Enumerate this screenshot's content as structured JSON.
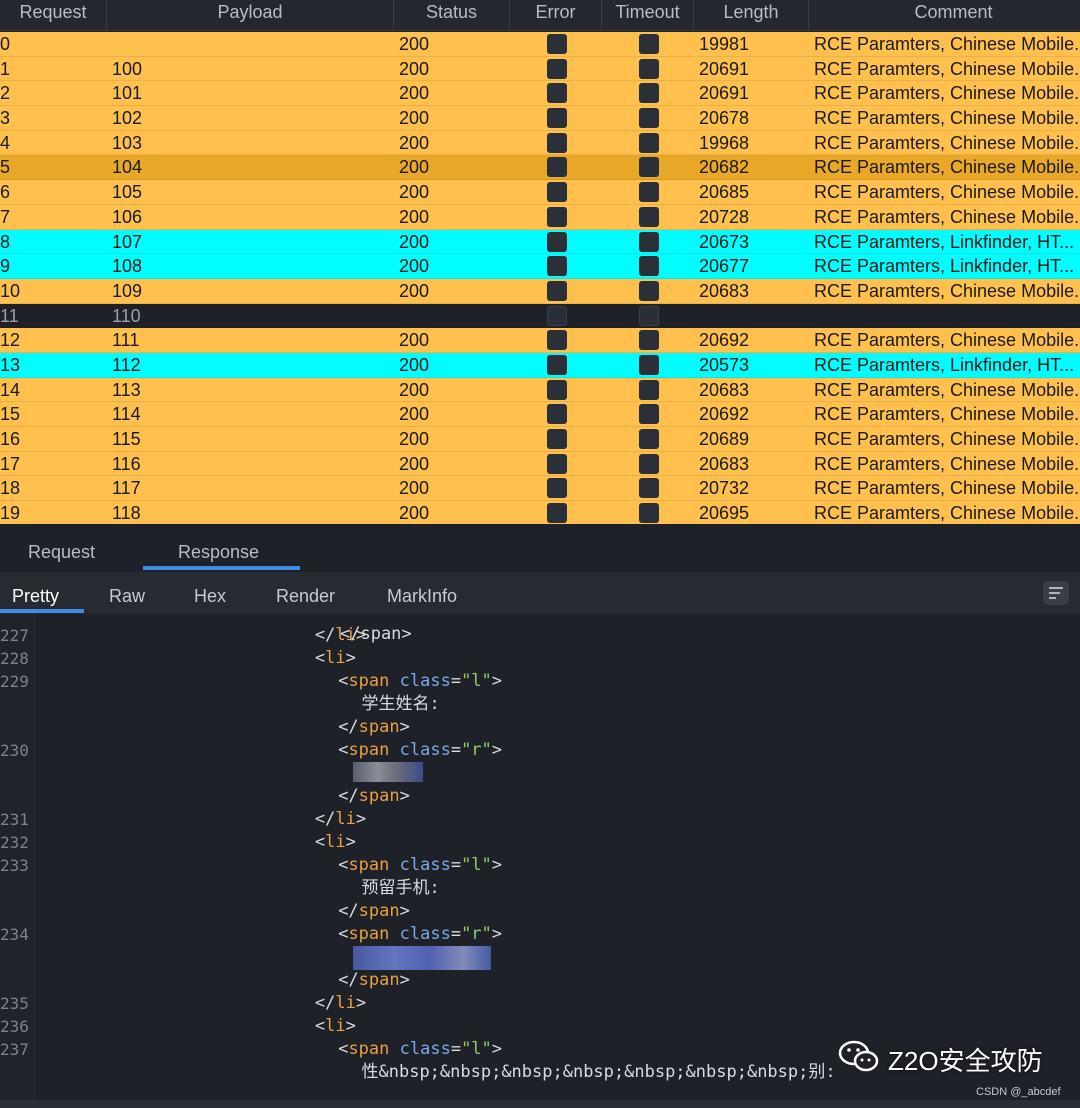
{
  "table": {
    "columns": [
      "Request",
      "Payload",
      "Status",
      "Error",
      "Timeout",
      "Length",
      "Comment"
    ],
    "rows": [
      {
        "request": "0",
        "payload": "",
        "status": "200",
        "length": "19981",
        "comment": "RCE Paramters, Chinese Mobile...",
        "color": "orange"
      },
      {
        "request": "1",
        "payload": "100",
        "status": "200",
        "length": "20691",
        "comment": "RCE Paramters, Chinese Mobile...",
        "color": "orange"
      },
      {
        "request": "2",
        "payload": "101",
        "status": "200",
        "length": "20691",
        "comment": "RCE Paramters, Chinese Mobile...",
        "color": "orange"
      },
      {
        "request": "3",
        "payload": "102",
        "status": "200",
        "length": "20678",
        "comment": "RCE Paramters, Chinese Mobile...",
        "color": "orange"
      },
      {
        "request": "4",
        "payload": "103",
        "status": "200",
        "length": "19968",
        "comment": "RCE Paramters, Chinese Mobile...",
        "color": "orange"
      },
      {
        "request": "5",
        "payload": "104",
        "status": "200",
        "length": "20682",
        "comment": "RCE Paramters, Chinese Mobile...",
        "color": "selected"
      },
      {
        "request": "6",
        "payload": "105",
        "status": "200",
        "length": "20685",
        "comment": "RCE Paramters, Chinese Mobile...",
        "color": "orange"
      },
      {
        "request": "7",
        "payload": "106",
        "status": "200",
        "length": "20728",
        "comment": "RCE Paramters, Chinese Mobile...",
        "color": "orange"
      },
      {
        "request": "8",
        "payload": "107",
        "status": "200",
        "length": "20673",
        "comment": "RCE Paramters, Linkfinder, HT...",
        "color": "cyan"
      },
      {
        "request": "9",
        "payload": "108",
        "status": "200",
        "length": "20677",
        "comment": "RCE Paramters, Linkfinder, HT...",
        "color": "cyan"
      },
      {
        "request": "10",
        "payload": "109",
        "status": "200",
        "length": "20683",
        "comment": "RCE Paramters, Chinese Mobile...",
        "color": "orange"
      },
      {
        "request": "11",
        "payload": "110",
        "status": "",
        "length": "",
        "comment": "",
        "color": "dark"
      },
      {
        "request": "12",
        "payload": "111",
        "status": "200",
        "length": "20692",
        "comment": "RCE Paramters, Chinese Mobile...",
        "color": "orange"
      },
      {
        "request": "13",
        "payload": "112",
        "status": "200",
        "length": "20573",
        "comment": "RCE Paramters, Linkfinder, HT...",
        "color": "cyan"
      },
      {
        "request": "14",
        "payload": "113",
        "status": "200",
        "length": "20683",
        "comment": "RCE Paramters, Chinese Mobile...",
        "color": "orange"
      },
      {
        "request": "15",
        "payload": "114",
        "status": "200",
        "length": "20692",
        "comment": "RCE Paramters, Chinese Mobile...",
        "color": "orange"
      },
      {
        "request": "16",
        "payload": "115",
        "status": "200",
        "length": "20689",
        "comment": "RCE Paramters, Chinese Mobile...",
        "color": "orange"
      },
      {
        "request": "17",
        "payload": "116",
        "status": "200",
        "length": "20683",
        "comment": "RCE Paramters, Chinese Mobile...",
        "color": "orange"
      },
      {
        "request": "18",
        "payload": "117",
        "status": "200",
        "length": "20732",
        "comment": "RCE Paramters, Chinese Mobile...",
        "color": "orange"
      },
      {
        "request": "19",
        "payload": "118",
        "status": "200",
        "length": "20695",
        "comment": "RCE Paramters, Chinese Mobile...",
        "color": "orange"
      }
    ]
  },
  "pane_tabs": {
    "request": "Request",
    "response": "Response"
  },
  "view_tabs": {
    "pretty": "Pretty",
    "raw": "Raw",
    "hex": "Hex",
    "render": "Render",
    "markinfo": "MarkInfo"
  },
  "code": {
    "lines": [
      {
        "num": "227",
        "indent": 13,
        "html": "</li>"
      },
      {
        "num": "228",
        "indent": 13,
        "html": "<li>"
      },
      {
        "num": "229",
        "indent": 14,
        "html": "<span class=\"l\">"
      },
      {
        "num": "",
        "indent": 15,
        "html": "学生姓名:"
      },
      {
        "num": "",
        "indent": 14,
        "html": "</span>"
      },
      {
        "num": "230",
        "indent": 14,
        "html": "<span class=\"r\">"
      },
      {
        "num": "",
        "indent": 15,
        "html": ""
      },
      {
        "num": "",
        "indent": 14,
        "html": "</span>"
      },
      {
        "num": "231",
        "indent": 13,
        "html": "</li>"
      },
      {
        "num": "232",
        "indent": 13,
        "html": "<li>"
      },
      {
        "num": "233",
        "indent": 14,
        "html": "<span class=\"l\">"
      },
      {
        "num": "",
        "indent": 15,
        "html": "预留手机:"
      },
      {
        "num": "",
        "indent": 14,
        "html": "</span>"
      },
      {
        "num": "234",
        "indent": 14,
        "html": "<span class=\"r\">"
      },
      {
        "num": "",
        "indent": 15,
        "html": ""
      },
      {
        "num": "",
        "indent": 14,
        "html": "</span>"
      },
      {
        "num": "235",
        "indent": 13,
        "html": "</li>"
      },
      {
        "num": "236",
        "indent": 13,
        "html": "<li>"
      },
      {
        "num": "237",
        "indent": 14,
        "html": "<span class=\"l\">"
      },
      {
        "num": "",
        "indent": 15,
        "html": "性&nbsp;&nbsp;&nbsp;&nbsp;&nbsp;&nbsp;&nbsp;别:"
      }
    ]
  },
  "watermark": {
    "main": "Z2O安全攻防",
    "sub": "CSDN @_abcdef"
  },
  "icons": {
    "wrap": "wrap-lines-icon",
    "wechat": "wechat-icon"
  },
  "colors": {
    "orange": "#ffc04d",
    "selected": "#eaa829",
    "cyan": "#00fefe",
    "accent": "#3d8ce8"
  }
}
